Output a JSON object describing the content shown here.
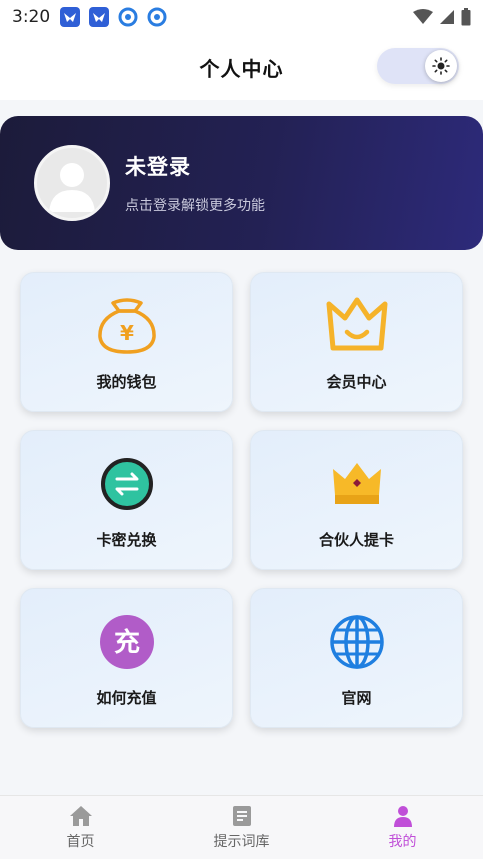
{
  "status_bar": {
    "time": "3:20"
  },
  "header": {
    "title": "个人中心"
  },
  "profile": {
    "name": "未登录",
    "hint": "点击登录解锁更多功能"
  },
  "cards": [
    {
      "label": "我的钱包",
      "icon": "money-bag-icon"
    },
    {
      "label": "会员中心",
      "icon": "crown-icon"
    },
    {
      "label": "卡密兑换",
      "icon": "exchange-icon"
    },
    {
      "label": "合伙人提卡",
      "icon": "gold-crown-icon"
    },
    {
      "label": "如何充值",
      "icon": "recharge-icon"
    },
    {
      "label": "官网",
      "icon": "globe-icon"
    }
  ],
  "bottom_nav": {
    "items": [
      {
        "label": "首页",
        "icon": "home-icon",
        "active": false
      },
      {
        "label": "提示词库",
        "icon": "document-icon",
        "active": false
      },
      {
        "label": "我的",
        "icon": "person-icon",
        "active": true
      }
    ]
  },
  "colors": {
    "accent": "#c04fd8",
    "profile_bg": "#232154",
    "card_bg": "#e8f1fb"
  }
}
